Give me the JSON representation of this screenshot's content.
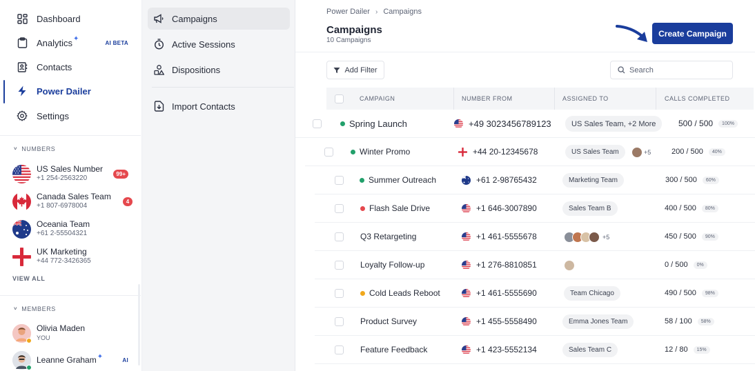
{
  "colors": {
    "brand": "#1a3d9c",
    "badge_red": "#e5484d",
    "green": "#22a06b",
    "red": "#e5484d",
    "amber": "#f0a81c"
  },
  "sidebar": {
    "nav": [
      {
        "label": "Dashboard",
        "icon": "dashboard-icon"
      },
      {
        "label": "Analytics",
        "icon": "clipboard-icon",
        "badge": "AI BETA"
      },
      {
        "label": "Contacts",
        "icon": "contacts-icon"
      },
      {
        "label": "Power Dailer",
        "icon": "lightning-icon",
        "active": true
      },
      {
        "label": "Settings",
        "icon": "gear-icon"
      }
    ],
    "numbers_heading": "NUMBERS",
    "numbers": [
      {
        "name": "US Sales Number",
        "phone": "+1 254-2563220",
        "badge": "99+",
        "flag": "us"
      },
      {
        "name": "Canada Sales Team",
        "phone": "+1 807-6978004",
        "badge": "4",
        "flag": "ca"
      },
      {
        "name": "Oceania Team",
        "phone": "+61 2-55504321",
        "flag": "au"
      },
      {
        "name": "UK Marketing",
        "phone": "+44 772-3426365",
        "flag": "uk"
      }
    ],
    "view_all": "VIEW ALL",
    "members_heading": "MEMBERS",
    "members": [
      {
        "name": "Olivia Maden",
        "sub": "YOU"
      },
      {
        "name": "Leanne Graham",
        "tag": "AI"
      }
    ]
  },
  "subnav": {
    "items": [
      {
        "label": "Campaigns",
        "icon": "megaphone-icon",
        "active": true
      },
      {
        "label": "Active Sessions",
        "icon": "timer-icon"
      },
      {
        "label": "Dispositions",
        "icon": "shapes-icon"
      },
      {
        "label": "Import Contacts",
        "icon": "import-icon"
      }
    ]
  },
  "main": {
    "breadcrumb": [
      "Power Dailer",
      "Campaigns"
    ],
    "title": "Campaigns",
    "subtitle": "10 Campaigns",
    "create_label": "Create Campaign",
    "filter_label": "Add Filter",
    "search_placeholder": "Search",
    "columns": [
      "CAMPAIGN",
      "NUMBER FROM",
      "ASSIGNED TO",
      "CALLS COMPLETED"
    ],
    "rows": [
      {
        "campaign": "Spring Launch",
        "dot": "green",
        "flag": "us",
        "number": "+49 3023456789123",
        "assigned": "US Sales Team, +2 More",
        "calls": "500 / 500",
        "pct": "100%"
      },
      {
        "campaign": "Winter Promo",
        "dot": "green",
        "flag": "uk",
        "number": "+44 20-12345678",
        "assigned": "US Sales Team",
        "extra": "+5",
        "calls": "200 / 500",
        "pct": "40%"
      },
      {
        "campaign": "Summer Outreach",
        "dot": "green",
        "flag": "au",
        "number": "+61 2-98765432",
        "assigned": "Marketing Team",
        "calls": "300 / 500",
        "pct": "60%"
      },
      {
        "campaign": "Flash Sale Drive",
        "dot": "red",
        "flag": "us",
        "number": "+1 646-3007890",
        "assigned": "Sales Team B",
        "calls": "400 / 500",
        "pct": "80%"
      },
      {
        "campaign": "Q3 Retargeting",
        "flag": "us",
        "number": "+1 461-5555678",
        "avatars": 4,
        "extra": "+5",
        "calls": "450 / 500",
        "pct": "90%"
      },
      {
        "campaign": "Loyalty Follow-up",
        "flag": "us",
        "number": "+1 276-8810851",
        "avatars": 1,
        "calls": "0 / 500",
        "pct": "0%"
      },
      {
        "campaign": "Cold Leads Reboot",
        "dot": "amber",
        "flag": "us",
        "number": "+1 461-5555690",
        "assigned": "Team Chicago",
        "calls": "490 / 500",
        "pct": "98%"
      },
      {
        "campaign": "Product Survey",
        "flag": "us",
        "number": "+1 455-5558490",
        "assigned": "Emma Jones Team",
        "calls": "58 / 100",
        "pct": "58%"
      },
      {
        "campaign": "Feature Feedback",
        "flag": "us",
        "number": "+1 423-5552134",
        "assigned": "Sales Team C",
        "calls": "12 / 80",
        "pct": "15%"
      }
    ]
  }
}
